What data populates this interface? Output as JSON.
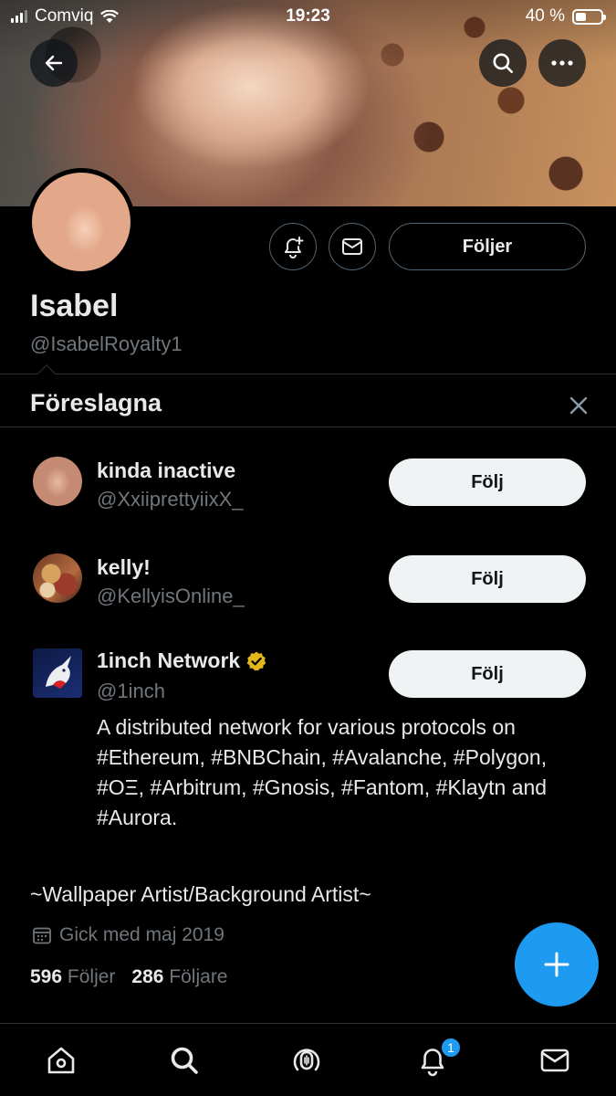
{
  "status_bar": {
    "carrier": "Comviq",
    "time": "19:23",
    "battery": "40 %"
  },
  "profile": {
    "name": "Isabel",
    "handle": "@IsabelRoyalty1",
    "following_button": "Följer",
    "bio": "~Wallpaper Artist/Background Artist~",
    "joined": "Gick med maj 2019",
    "following_count": "596",
    "following_label": "Följer",
    "followers_count": "286",
    "followers_label": "Följare"
  },
  "suggested": {
    "title": "Föreslagna",
    "items": [
      {
        "name": "kinda inactive",
        "handle": "@XxiiprettyiixX_",
        "button": "Följ"
      },
      {
        "name": "kelly!",
        "handle": "@KellyisOnline_",
        "button": "Följ"
      },
      {
        "name": "1inch Network",
        "handle": "@1inch",
        "button": "Följ",
        "verified": true,
        "bio": "A distributed network for various protocols on #Ethereum, #BNBChain, #Avalanche, #Polygon, #OΞ, #Arbitrum, #Gnosis, #Fantom, #Klaytn and #Aurora."
      }
    ]
  },
  "tabbar": {
    "notification_badge": "1"
  },
  "colors": {
    "accent": "#1d9bf0",
    "background": "#000000",
    "secondary_text": "#71767b",
    "verified_gold": "#e2b719"
  }
}
